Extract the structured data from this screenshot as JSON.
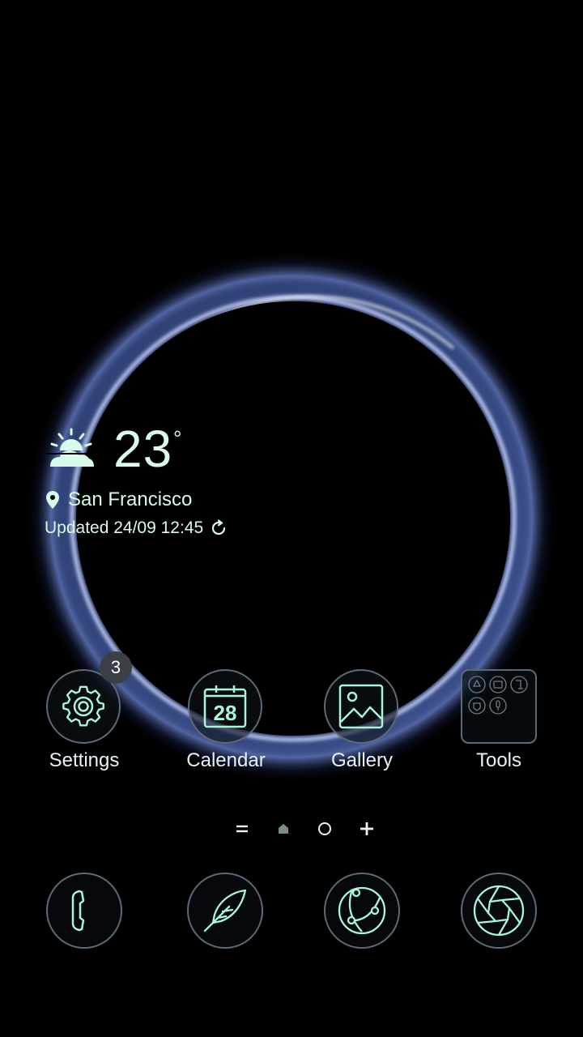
{
  "weather": {
    "temperature": "23",
    "unit": "°",
    "location": "San Francisco",
    "updated": "Updated 24/09 12:45",
    "icon": "partly-cloudy-icon"
  },
  "apps": [
    {
      "label": "Settings",
      "icon": "gear-icon",
      "badge": "3"
    },
    {
      "label": "Calendar",
      "icon": "calendar-icon",
      "day": "28"
    },
    {
      "label": "Gallery",
      "icon": "image-icon"
    },
    {
      "label": "Tools",
      "icon": "folder-icon"
    }
  ],
  "page_indicator": {
    "items": [
      "menu-icon",
      "home-icon",
      "page-dot",
      "add-page-icon"
    ]
  },
  "dock": [
    {
      "icon": "phone-icon"
    },
    {
      "icon": "feather-icon"
    },
    {
      "icon": "browser-icon"
    },
    {
      "icon": "camera-aperture-icon"
    }
  ],
  "colors": {
    "accent": "#9ff7d6",
    "icon_stroke": "#a8f5dc",
    "ring_glow": "#8aa6ff"
  }
}
